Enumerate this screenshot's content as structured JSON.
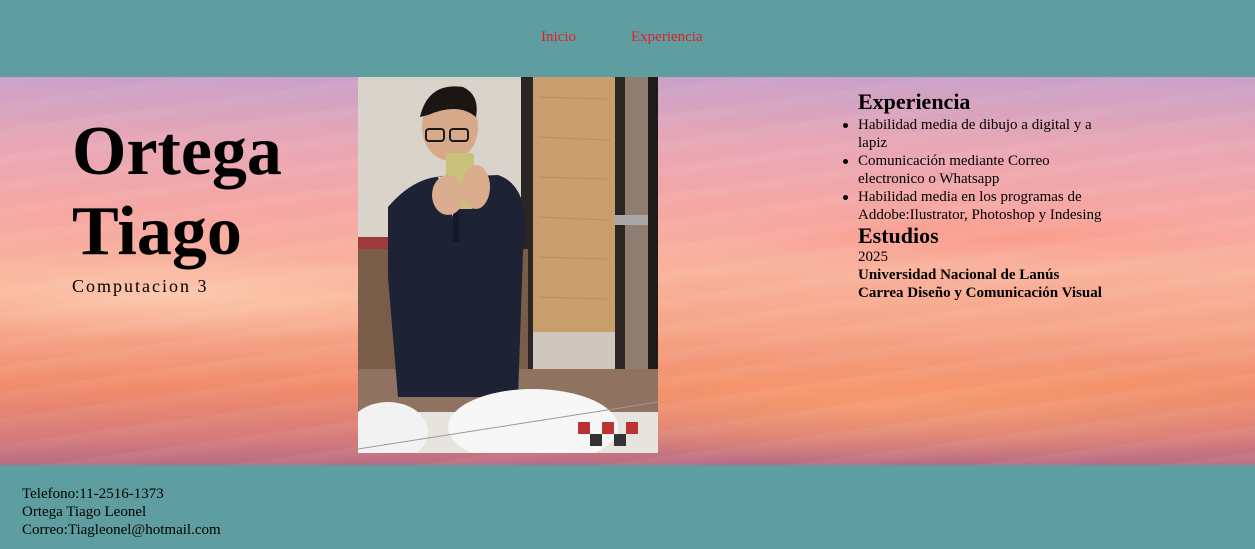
{
  "nav": {
    "links": [
      "Inicio",
      "Experiencia"
    ]
  },
  "hero": {
    "name_line1": "Ortega",
    "name_line2": "Tiago",
    "subtitle": "Computacion 3"
  },
  "experience": {
    "heading": "Experiencia",
    "items": [
      "Habilidad media de dibujo a digital y a lapiz",
      "Comunicación mediante Correo electronico o Whatsapp",
      "Habilidad media en los programas de Addobe:Ilustrator, Photoshop y Indesing"
    ]
  },
  "studies": {
    "heading": "Estudios",
    "year": "2025",
    "university": "Universidad Nacional de Lanús",
    "career": "Carrea Diseño y Comunicación Visual"
  },
  "footer": {
    "phone": "Telefono:11-2516-1373",
    "full_name": "Ortega Tiago Leonel",
    "email": "Correo:Tiagleonel@hotmail.com"
  },
  "colors": {
    "bar_background": "#5f9ea0",
    "nav_link": "#e0202a"
  }
}
